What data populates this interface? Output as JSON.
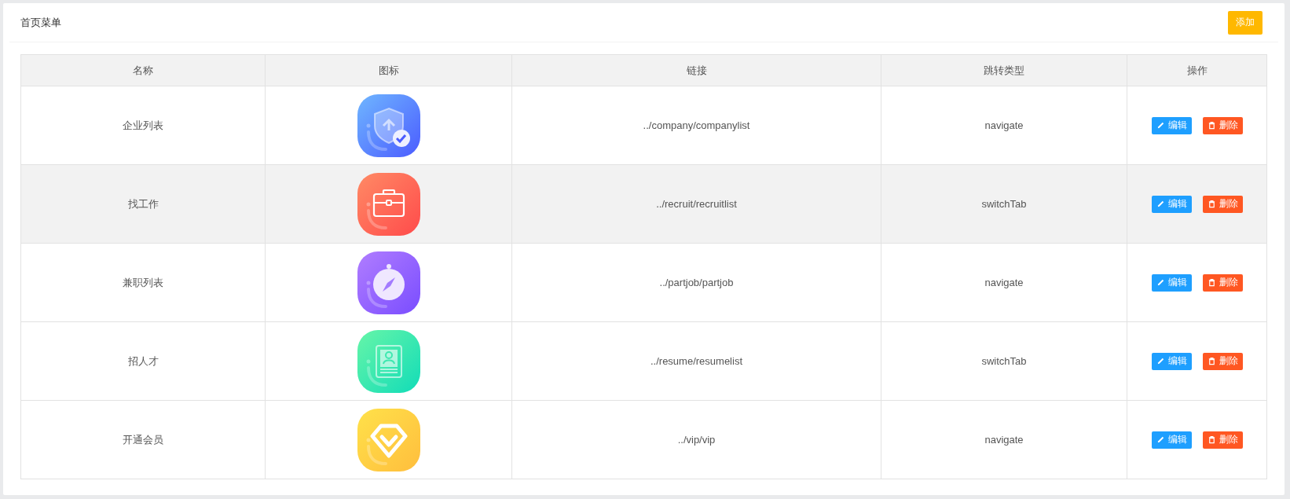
{
  "panel": {
    "title": "首页菜单",
    "add_button": "添加"
  },
  "table": {
    "columns": [
      "名称",
      "图标",
      "链接",
      "跳转类型",
      "操作"
    ],
    "rows": [
      {
        "name": "企业列表",
        "icon": {
          "kind": "shield"
        },
        "link": "../company/companylist",
        "type": "navigate",
        "highlighted": false,
        "edit": "编辑",
        "delete": "删除"
      },
      {
        "name": "找工作",
        "icon": {
          "kind": "briefcase"
        },
        "link": "../recruit/recruitlist",
        "type": "switchTab",
        "highlighted": true,
        "edit": "编辑",
        "delete": "删除"
      },
      {
        "name": "兼职列表",
        "icon": {
          "kind": "compass"
        },
        "link": "../partjob/partjob",
        "type": "navigate",
        "highlighted": false,
        "edit": "编辑",
        "delete": "删除"
      },
      {
        "name": "招人才",
        "icon": {
          "kind": "resume"
        },
        "link": "../resume/resumelist",
        "type": "switchTab",
        "highlighted": false,
        "edit": "编辑",
        "delete": "删除"
      },
      {
        "name": "开通会员",
        "icon": {
          "kind": "diamond"
        },
        "link": "../vip/vip",
        "type": "navigate",
        "highlighted": false,
        "edit": "编辑",
        "delete": "删除"
      }
    ]
  }
}
